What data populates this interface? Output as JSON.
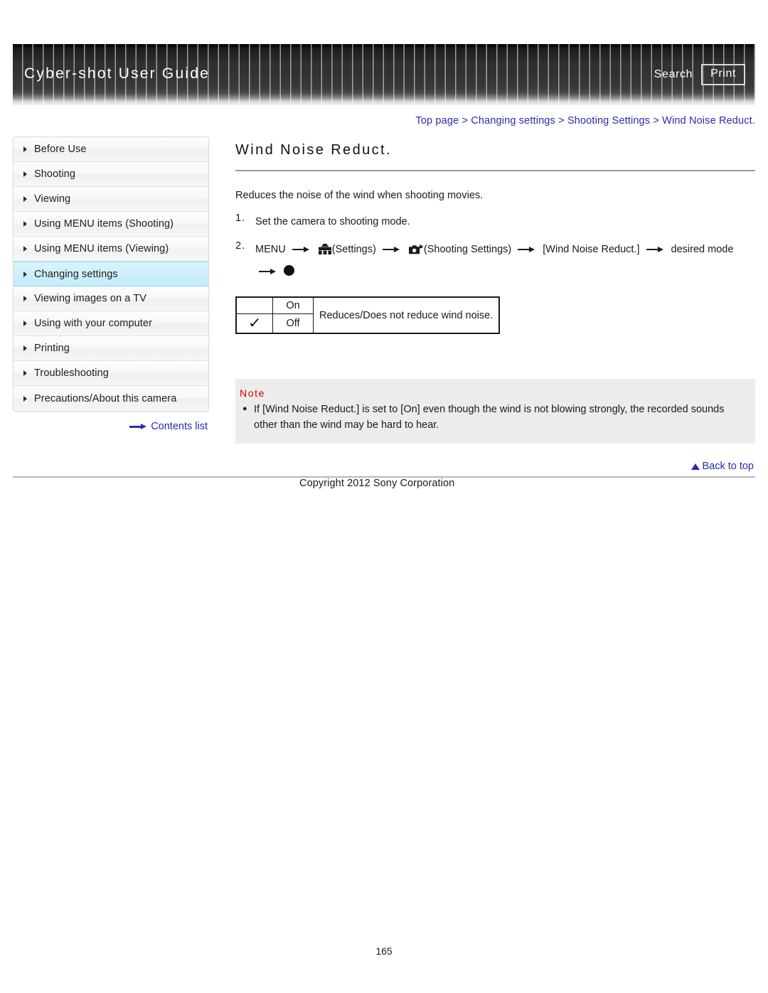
{
  "header": {
    "title": "Cyber-shot User Guide",
    "search_label": "Search",
    "print_label": "Print"
  },
  "breadcrumb": {
    "items": [
      "Top page",
      "Changing settings",
      "Shooting Settings",
      "Wind Noise Reduct."
    ],
    "separator": ">"
  },
  "sidebar": {
    "items": [
      {
        "label": "Before Use",
        "active": false
      },
      {
        "label": "Shooting",
        "active": false
      },
      {
        "label": "Viewing",
        "active": false
      },
      {
        "label": "Using MENU items (Shooting)",
        "active": false
      },
      {
        "label": "Using MENU items (Viewing)",
        "active": false
      },
      {
        "label": "Changing settings",
        "active": true
      },
      {
        "label": "Viewing images on a TV",
        "active": false
      },
      {
        "label": "Using with your computer",
        "active": false
      },
      {
        "label": "Printing",
        "active": false
      },
      {
        "label": "Troubleshooting",
        "active": false
      },
      {
        "label": "Precautions/About this camera",
        "active": false
      }
    ],
    "contents_link": "Contents list"
  },
  "main": {
    "page_title": "Wind Noise Reduct.",
    "intro": "Reduces the noise of the wind when shooting movies.",
    "step1": {
      "number": "1.",
      "text": "Set the camera to shooting mode."
    },
    "step2": {
      "number": "2.",
      "menu_label": "MENU",
      "settings_label": "(Settings)",
      "shooting_settings_label": "(Shooting Settings)",
      "item_label": "[Wind Noise Reduct.]",
      "desired_mode_label": "desired mode",
      "settings_icon": "toolbox-icon",
      "shooting_settings_icon": "camera-wrench-icon",
      "record_icon": "record-dot-icon"
    },
    "table": {
      "rows": [
        {
          "check": "",
          "value": "On"
        },
        {
          "check": "✓",
          "value": "Off"
        }
      ],
      "description": "Reduces/Does not reduce wind noise."
    },
    "note": {
      "title": "Note",
      "bullet": "●",
      "items": [
        "If [Wind Noise Reduct.] is set to [On] even though the wind is not blowing strongly, the recorded sounds other than the wind may be hard to hear."
      ]
    }
  },
  "footer": {
    "back_to_top": "Back to top",
    "copyright": "Copyright 2012 Sony Corporation",
    "page_number": "165"
  },
  "colors": {
    "link": "#2a2ab0",
    "note_title": "#d00000",
    "active_sidebar": "#cdf0fa",
    "header_dark": "#2e2e2e"
  }
}
